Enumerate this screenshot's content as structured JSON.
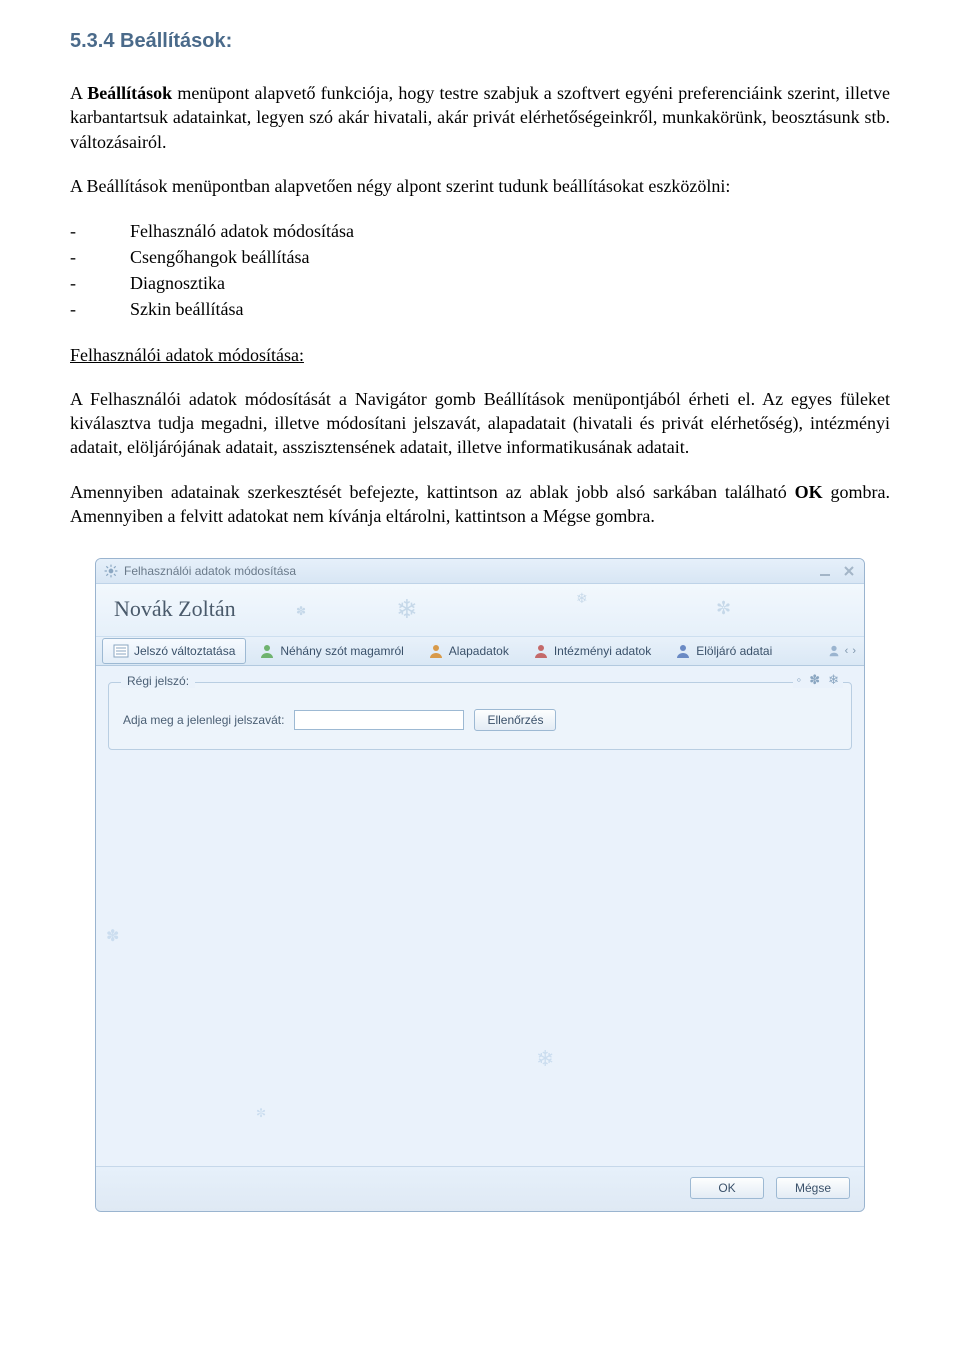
{
  "doc": {
    "section_title": "5.3.4 Beállítások:",
    "p1": "A Beállítások menüpont alapvető funkciója, hogy testre szabjuk a szoftvert egyéni preferenciáink szerint, illetve karbantartsuk adatainkat, legyen szó akár hivatali, akár privát elérhetőségeinkről, munkakörünk, beosztásunk stb. változásairól.",
    "p2": "A Beállítások menüpontban alapvetően négy alpont szerint tudunk beállításokat eszközölni:",
    "bullets": [
      "Felhasználó adatok módosítása",
      "Csengőhangok beállítása",
      "Diagnosztika",
      "Szkin beállítása"
    ],
    "subhead": "Felhasználói adatok módosítása:",
    "p3": "A Felhasználói adatok módosítását a Navigátor gomb Beállítások menüpontjából érheti el. Az egyes füleket kiválasztva tudja megadni, illetve módosítani jelszavát, alapadatait (hivatali és privát elérhetőség), intézményi adatait, elöljárójának adatait, asszisztensének adatait, illetve informatikusának adatait.",
    "p4_a": "Amennyiben adatainak szerkesztését befejezte, kattintson az ablak jobb alsó sarkában található ",
    "p4_ok": "OK",
    "p4_b": " gombra. Amennyiben a felvitt adatokat nem kívánja eltárolni, kattintson a Mégse gombra."
  },
  "window": {
    "title": "Felhasználói adatok módosítása",
    "username": "Novák Zoltán",
    "tabs": [
      {
        "label": "Jelszó változtatása",
        "active": true,
        "icon": "list"
      },
      {
        "label": "Néhány szót magamról",
        "active": false,
        "icon": "person-green"
      },
      {
        "label": "Alapadatok",
        "active": false,
        "icon": "person-orange"
      },
      {
        "label": "Intézményi adatok",
        "active": false,
        "icon": "person-red"
      },
      {
        "label": "Elöljáró adatai",
        "active": false,
        "icon": "person-blue"
      }
    ],
    "group_legend": "Régi jelszó:",
    "pw_label": "Adja meg a jelenlegi jelszavát:",
    "pw_value": "",
    "verify_btn": "Ellenőrzés",
    "footer": {
      "ok": "OK",
      "cancel": "Mégse"
    }
  }
}
